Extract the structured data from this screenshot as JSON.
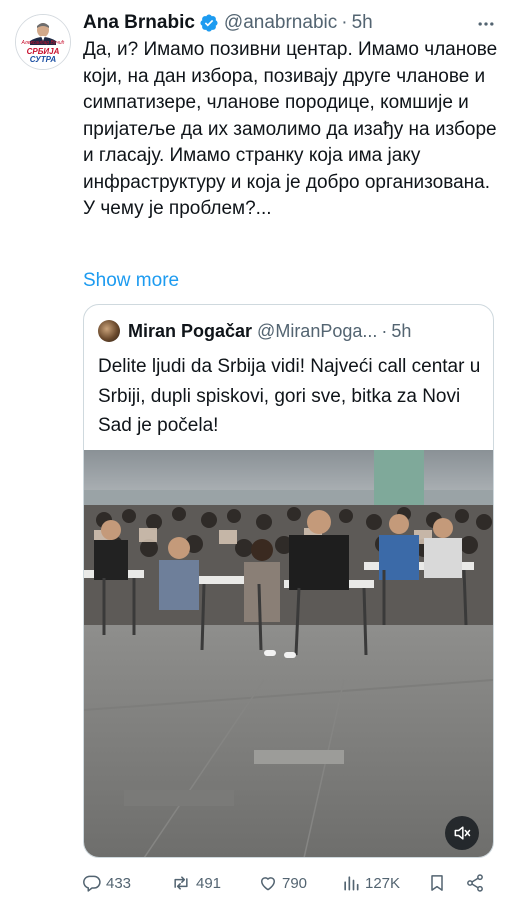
{
  "author": {
    "name": "Ana Brnabic",
    "handle": "@anabrnabic",
    "separator": "·",
    "time": "5h",
    "avatar": {
      "small_line": "Александар Вучић",
      "line1": "СРБИЈА",
      "line2": "СУТРА"
    }
  },
  "tweet": {
    "text": "Да, и? Имамо позивни центар. Имамо чланове који, на дан избора, позивају друге чланове и симпатизере, чланове породице, комшије и пријатеље да их замолимо да изађу на изборе и гласају. Имамо странку која има јаку инфраструктуру и која је добро организована. У чему је проблем?...",
    "show_more": "Show more"
  },
  "quoted": {
    "name": "Miran Pogačar",
    "handle": "@MiranPoga...",
    "separator": "·",
    "time": "5h",
    "text": "Delite ljudi da Srbija vidi! Najveći call centar u Srbiji, dupli spiskovi, gori sve, bitka za Novi Sad je počela!"
  },
  "actions": {
    "replies": "433",
    "retweets": "491",
    "likes": "790",
    "views": "127K"
  },
  "colors": {
    "accent": "#1d9bf0",
    "muted": "#536471",
    "text": "#0f1419"
  },
  "icons": [
    "verified-badge-icon",
    "more-icon",
    "mute-icon",
    "reply-icon",
    "retweet-icon",
    "like-icon",
    "views-icon",
    "bookmark-icon",
    "share-icon"
  ]
}
